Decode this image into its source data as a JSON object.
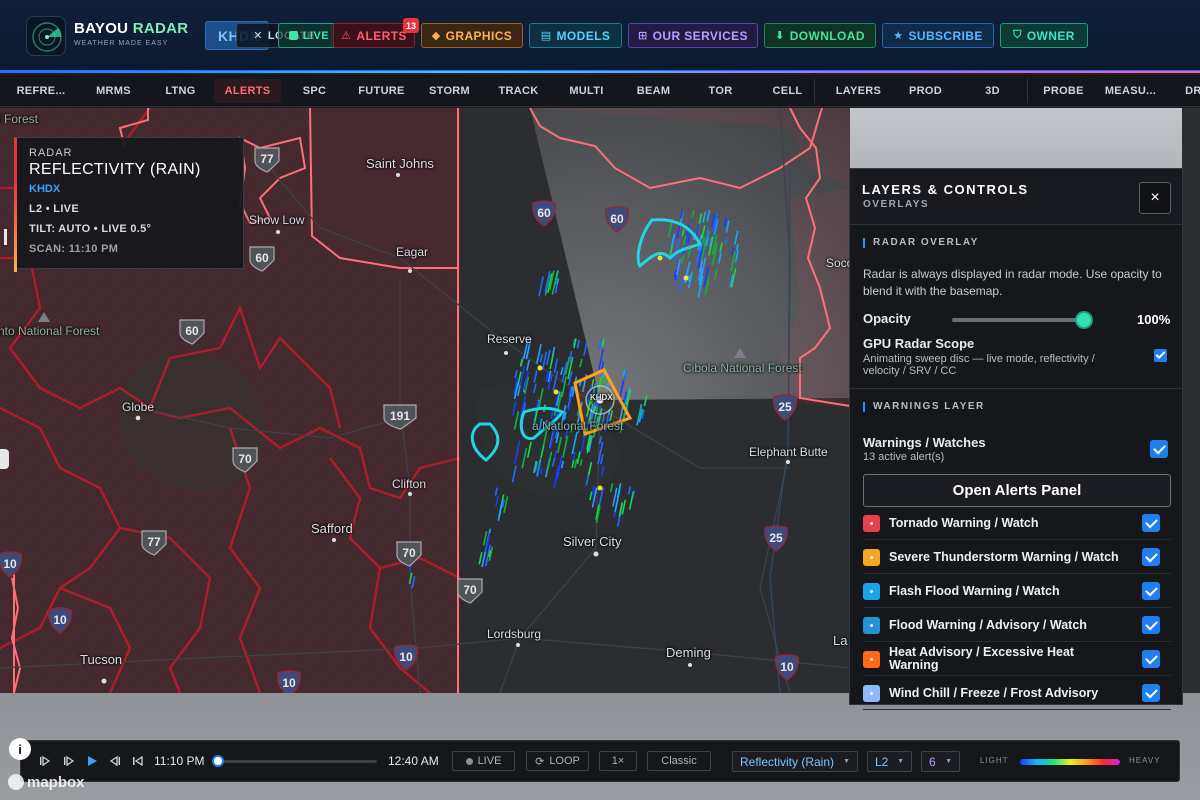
{
  "header": {
    "brand_title_a": "BAYOU ",
    "brand_title_b": "RADAR",
    "brand_subtitle": "WEATHER MADE EASY",
    "site_button": "KHDX",
    "locate_label": "LOCATE",
    "live_label": "LIVE",
    "alerts_label": "ALERTS",
    "alerts_badge": "13",
    "graphics_label": "GRAPHICS",
    "models_label": "MODELS",
    "services_label": "OUR SERVICES",
    "download_label": "DOWNLOAD",
    "subscribe_label": "SUBSCRIBE",
    "owner_label": "OWNER",
    "icons": {
      "alerts": "warning-triangle-icon",
      "graphics": "diamond-icon",
      "models": "layers-grid-icon",
      "services": "grid-plus-icon",
      "download": "download-arrow-icon",
      "subscribe": "star-icon",
      "owner": "shield-icon"
    }
  },
  "product_tabs": [
    "REFRE...",
    "MRMS",
    "LTNG",
    "ALERTS",
    "SPC",
    "FUTURE",
    "STORM",
    "TRACK",
    "MULTI",
    "BEAM",
    "TOR",
    "CELL",
    "LAYERS",
    "PROD",
    "3D",
    "PROBE",
    "MEASU...",
    "DRA"
  ],
  "active_tab": "ALERTS",
  "info_card": {
    "category": "RADAR",
    "product": "REFLECTIVITY (RAIN)",
    "site": "KHDX",
    "mode": "L2 • LIVE",
    "tilt": "TILT: AUTO • LIVE 0.5°",
    "scan": "SCAN: 11:10 PM"
  },
  "map": {
    "places": {
      "forest_nw": "l Forest",
      "saint_johns": "Saint Johns",
      "show_low": "Show Low",
      "eagar": "Eagar",
      "socorro": "Soco",
      "national_forest_w": "nto National Forest",
      "globe": "Globe",
      "reserve": "Reserve",
      "cibola": "Cibola National Forest",
      "gila_forest": "a National Forest",
      "elephant_butte": "Elephant Butte",
      "safford": "Safford",
      "clifton": "Clifton",
      "silver_city": "Silver City",
      "lordsburg": "Lordsburg",
      "deming": "Deming",
      "tucson": "Tucson",
      "las_cruces": "La",
      "radar_site": "KHDX"
    },
    "shields": {
      "us77_a": "77",
      "i40_a": "60",
      "i40_b": "60",
      "us60": "60",
      "us60_b": "60",
      "us191": "191",
      "us70": "70",
      "us70_b": "70",
      "us70_c": "70",
      "us77_b": "77",
      "i25_a": "25",
      "i25_b": "25",
      "i10_a": "10",
      "i10_b": "10",
      "i10_c": "10",
      "i10_d": "10",
      "i10_e": "10"
    }
  },
  "panel": {
    "title": "LAYERS & CONTROLS",
    "subtitle": "OVERLAYS",
    "close_label": "×",
    "radar_section": "RADAR OVERLAY",
    "radar_desc": "Radar is always displayed in radar mode. Use opacity to blend it with the basemap.",
    "opacity_label": "Opacity",
    "opacity_value": "100%",
    "opacity": 1.0,
    "gpu_label": "GPU Radar Scope",
    "gpu_desc": "Animating sweep disc — live mode, reflectivity / velocity / SRV / CC",
    "gpu_enabled": true,
    "warnings_section": "WARNINGS LAYER",
    "warnings_label": "Warnings / Watches",
    "warnings_count": "13 active alert(s)",
    "warnings_enabled": true,
    "open_alerts_button": "Open Alerts Panel",
    "alert_types": [
      {
        "label": "Tornado Warning / Watch",
        "color": "#e8404f",
        "checked": true
      },
      {
        "label": "Severe Thunderstorm Warning / Watch",
        "color": "#f5a623",
        "checked": true
      },
      {
        "label": "Flash Flood Warning / Watch",
        "color": "#1aa3e8",
        "checked": true
      },
      {
        "label": "Flood Warning / Advisory / Watch",
        "color": "#2193d6",
        "checked": true
      },
      {
        "label": "Heat Advisory / Excessive Heat Warning",
        "color": "#ff6a1a",
        "checked": true
      },
      {
        "label": "Wind Chill / Freeze / Frost Advisory",
        "color": "#8fb8ff",
        "checked": true
      }
    ]
  },
  "timeline": {
    "start_time": "11:10 PM",
    "end_time": "12:40 AM",
    "live_label": "LIVE",
    "loop_label": "LOOP",
    "speed_label": "1×",
    "style_label": "Classic",
    "product_select": "Reflectivity (Rain)",
    "level_select": "L2",
    "count_select": "6",
    "legend_low": "LIGHT",
    "legend_high": "HEAVY",
    "progress": 0.0
  },
  "attribution": {
    "mapbox": "mapbox",
    "info": "i"
  }
}
